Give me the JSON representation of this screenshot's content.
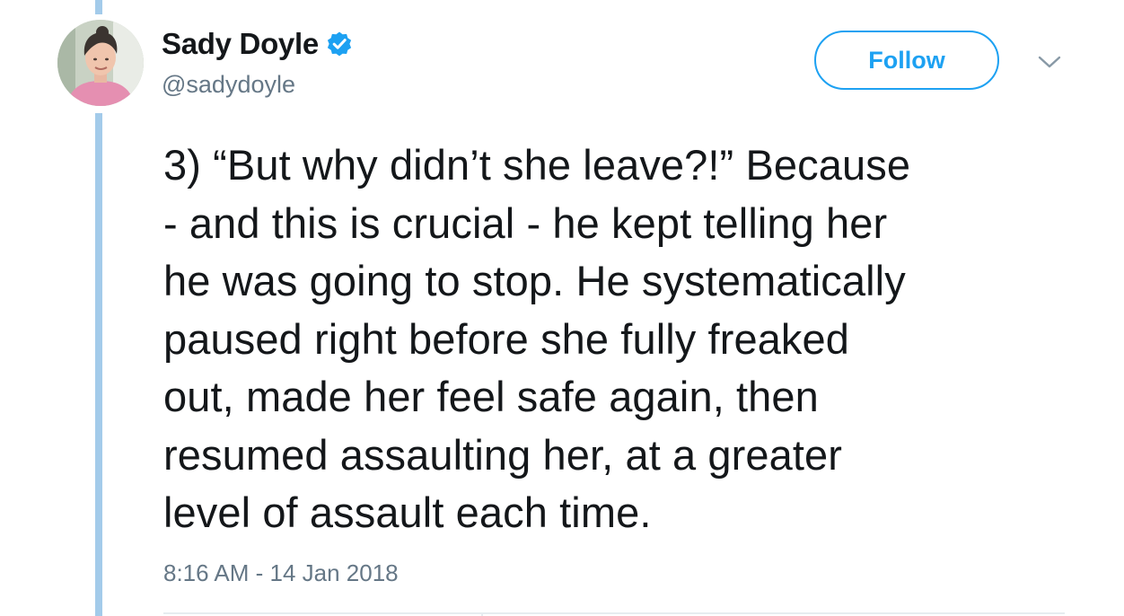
{
  "tweet": {
    "author": {
      "display_name": "Sady Doyle",
      "handle": "@sadydoyle",
      "verified": true
    },
    "follow_label": "Follow",
    "text": "3) “But why didn’t she leave?!” Because\n- and this is crucial - he kept telling her\nhe was going to stop. He systematically\npaused right before she fully freaked\nout, made her feel safe again, then\nresumed assaulting her, at a greater\nlevel of assault each time.",
    "timestamp": "8:16 AM - 14 Jan 2018"
  },
  "icons": {
    "verified": "verified-badge-icon",
    "more": "chevron-down-icon",
    "avatar": "profile-photo"
  },
  "colors": {
    "accent": "#1da1f2",
    "thread_line": "#a3cbea",
    "secondary_text": "#657786",
    "primary_text": "#14171a"
  }
}
